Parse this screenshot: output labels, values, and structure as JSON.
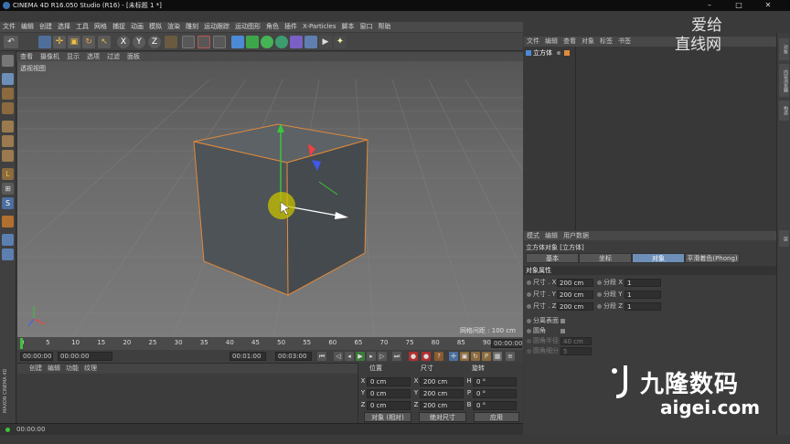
{
  "window": {
    "title": "CINEMA 4D R16.050 Studio (R16) - [未标题 1 *]",
    "controls": [
      "–",
      "□",
      "✕"
    ]
  },
  "menubar": [
    "文件",
    "编辑",
    "创建",
    "选择",
    "工具",
    "网格",
    "捕捉",
    "动画",
    "模拟",
    "渲染",
    "雕刻",
    "运动跟踪",
    "运动图形",
    "角色",
    "插件",
    "X-Particles",
    "脚本",
    "窗口",
    "帮助"
  ],
  "toolbar": {
    "axis_buttons": [
      "X",
      "Y",
      "Z"
    ]
  },
  "viewport": {
    "menu": [
      "查看",
      "摄像机",
      "显示",
      "选项",
      "过滤",
      "面板"
    ],
    "label": "透视视图",
    "grid_readout": "网格间距 : 100 cm"
  },
  "timeline": {
    "ticks": [
      "0",
      "5",
      "10",
      "15",
      "20",
      "25",
      "30",
      "35",
      "40",
      "45",
      "50",
      "55",
      "60",
      "65",
      "70",
      "75",
      "80",
      "85",
      "90"
    ],
    "end_frame": "00:00:00"
  },
  "playback": {
    "current_time": "00:00:00",
    "start_time": "00:00:00",
    "preview_end": "00:01:00",
    "end_time": "00:03:00"
  },
  "material_panel": {
    "menu": [
      "创建",
      "编辑",
      "功能",
      "纹理"
    ]
  },
  "coords": {
    "headers": [
      "位置",
      "尺寸",
      "旋转"
    ],
    "rows": [
      {
        "axis": "X",
        "pos": "0 cm",
        "size_axis": "X",
        "size": "200 cm",
        "rot_axis": "H",
        "rot": "0 °"
      },
      {
        "axis": "Y",
        "pos": "0 cm",
        "size_axis": "Y",
        "size": "200 cm",
        "rot_axis": "P",
        "rot": "0 °"
      },
      {
        "axis": "Z",
        "pos": "0 cm",
        "size_axis": "Z",
        "size": "200 cm",
        "rot_axis": "B",
        "rot": "0 °"
      }
    ],
    "mode_select": "对象 (相对)",
    "size_select": "绝对尺寸",
    "apply_button": "应用"
  },
  "status": {
    "time": "00:00:00",
    "maxon": "MAXON CINEMA 4D"
  },
  "object_manager": {
    "menu": [
      "文件",
      "编辑",
      "查看",
      "对象",
      "标签",
      "书签"
    ],
    "objects": [
      {
        "name": "立方体"
      }
    ]
  },
  "attribute_manager": {
    "menu": [
      "模式",
      "编辑",
      "用户数据"
    ],
    "title": "立方体对象 [立方体]",
    "tabs": [
      "基本",
      "坐标",
      "对象",
      "平滑着色(Phong)"
    ],
    "active_tab": "对象",
    "section": "对象属性",
    "size_rows": [
      {
        "label": "尺寸 . X",
        "value": "200 cm",
        "seg_label": "分段 X",
        "seg": "1"
      },
      {
        "label": "尺寸 . Y",
        "value": "200 cm",
        "seg_label": "分段 Y",
        "seg": "1"
      },
      {
        "label": "尺寸 . Z",
        "value": "200 cm",
        "seg_label": "分段 Z",
        "seg": "1"
      }
    ],
    "separate_surfaces": "分离表面",
    "fillet": "圆角",
    "fillet_radius_label": "圆角半径",
    "fillet_radius": "40 cm",
    "fillet_subdiv_label": "圆角细分",
    "fillet_subdiv": "5"
  },
  "right_tabs": [
    "对象",
    "内容浏览器",
    "构造",
    "层"
  ],
  "watermarks": {
    "top_line1": "爱给",
    "top_line2": "直线网",
    "bottom_brand": "九隆数码",
    "bottom_url": "aigei.com"
  },
  "colors": {
    "accent_blue": "#6d8fb8",
    "cube_outline": "#e08a3c",
    "gizmo_y": "#3cc43c",
    "gizmo_z": "#3c5cff",
    "gizmo_x": "#ff3c3c"
  }
}
